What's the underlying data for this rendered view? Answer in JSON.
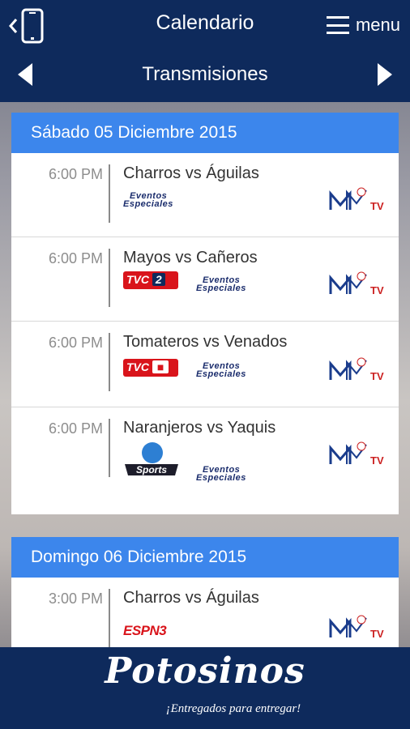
{
  "header": {
    "title": "Calendario",
    "menu_label": "menu",
    "subtitle": "Transmisiones"
  },
  "days": [
    {
      "label": "Sábado 05 Diciembre 2015",
      "events": [
        {
          "time": "6:00 PM",
          "match": "Charros vs Águilas",
          "channels": [
            "Eventos Especiales",
            "MTV"
          ]
        },
        {
          "time": "6:00 PM",
          "match": "Mayos vs Cañeros",
          "channels": [
            "TVC Deportes 2",
            "Eventos Especiales",
            "MTV"
          ]
        },
        {
          "time": "6:00 PM",
          "match": "Tomateros vs Venados",
          "channels": [
            "TVC Deportes",
            "Eventos Especiales",
            "MTV"
          ]
        },
        {
          "time": "6:00 PM",
          "match": "Naranjeros vs Yaquis",
          "channels": [
            "Sports",
            "Eventos Especiales",
            "MTV"
          ]
        }
      ]
    },
    {
      "label": "Domingo 06 Diciembre 2015",
      "events": [
        {
          "time": "3:00 PM",
          "match": "Charros vs Águilas",
          "channels": [
            "ESPN 3",
            "MTV"
          ]
        }
      ]
    }
  ],
  "logo_text": {
    "eventos_line1": "Eventos",
    "eventos_line2": "Especiales",
    "tvc": "TVC",
    "tvc_num": "2",
    "espn": "ESPN3",
    "sports": "Sports",
    "mtv_tv": "TV"
  },
  "footer": {
    "brand": "Potosinos",
    "tagline": "¡Entregados para entregar!"
  },
  "colors": {
    "nav_bg": "#0e2a5c",
    "day_header": "#3c86ec",
    "tvc_red": "#d9141b"
  }
}
